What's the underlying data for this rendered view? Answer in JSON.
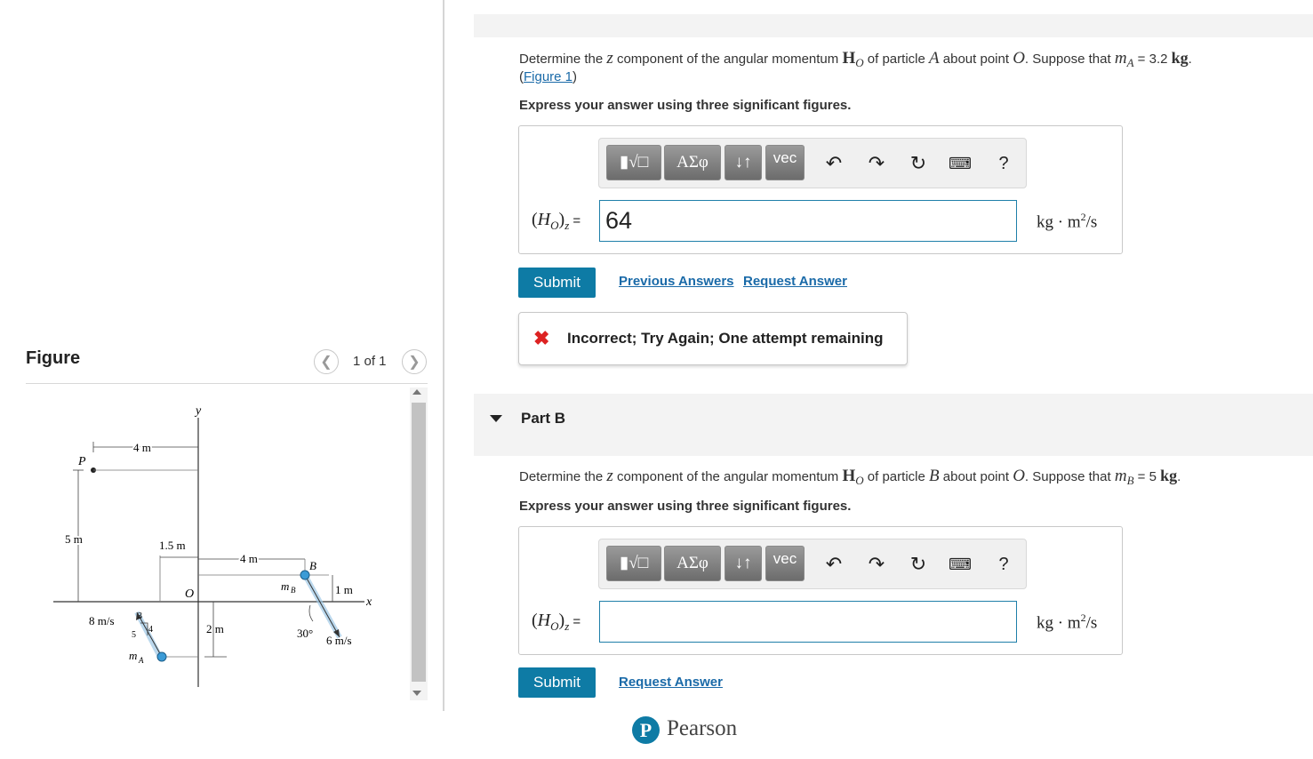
{
  "figure_panel": {
    "title": "Figure",
    "pager_text": "1 of 1",
    "prev_icon": "chevron-left-icon",
    "next_icon": "chevron-right-icon",
    "labels": {
      "y_axis": "y",
      "x_axis": "x",
      "origin": "O",
      "point_p": "P",
      "dim_4m_top": "4 m",
      "dim_5m": "5 m",
      "dim_1_5m": "1.5 m",
      "dim_4m_mid": "4 m",
      "dim_1m": "1 m",
      "dim_2m": "2 m",
      "point_b": "B",
      "mass_b": "m",
      "mass_b_sub": "B",
      "mass_a": "m",
      "mass_a_sub": "A",
      "speed_a": "8 m/s",
      "speed_b": "6 m/s",
      "angle_b": "30°",
      "tri_3": "3",
      "tri_4": "4",
      "tri_5": "5"
    }
  },
  "part_a": {
    "q_pre": "Determine the ",
    "q_z": "z",
    "q_mid1": " component of the angular momentum ",
    "q_H": "H",
    "q_Hsub": "O",
    "q_mid2": " of particle ",
    "q_particle": "A",
    "q_mid3": " about point ",
    "q_point": "O",
    "q_mid4": ". Suppose that ",
    "q_m": "m",
    "q_msub": "A",
    "q_eq": " = 3.2 ",
    "q_unit": "kg",
    "q_end": ".",
    "figure_link": "Figure 1",
    "instruction": "Express your answer using three significant figures.",
    "answer_label": "(HO)z =",
    "answer_value": "64",
    "units": "kg · m²/s",
    "submit_label": "Submit",
    "previous_answers_label": "Previous Answers",
    "request_answer_label": "Request Answer",
    "feedback": "Incorrect; Try Again; One attempt remaining"
  },
  "toolbar": {
    "templates_icon": "radical-template-icon",
    "greek_label": "ΑΣφ",
    "arrows_label": "↓↑",
    "vec_label": "vec",
    "undo_icon": "undo-icon",
    "redo_icon": "redo-icon",
    "reset_icon": "reset-icon",
    "keyboard_icon": "keyboard-icon",
    "help_label": "?"
  },
  "part_b": {
    "title": "Part B",
    "q_pre": "Determine the ",
    "q_z": "z",
    "q_mid1": " component of the angular momentum ",
    "q_H": "H",
    "q_Hsub": "O",
    "q_mid2": " of particle ",
    "q_particle": "B",
    "q_mid3": " about point ",
    "q_point": "O",
    "q_mid4": ". Suppose that ",
    "q_m": "m",
    "q_msub": "B",
    "q_eq": " = 5 ",
    "q_unit": "kg",
    "q_end": ".",
    "instruction": "Express your answer using three significant figures.",
    "answer_label": "(HO)z =",
    "answer_value": "",
    "units": "kg · m²/s",
    "submit_label": "Submit",
    "request_answer_label": "Request Answer"
  },
  "footer": {
    "brand": "Pearson",
    "logo_letter": "P"
  },
  "colors": {
    "accent": "#0e7ba5",
    "link": "#1a6aa8",
    "error": "#dd2222",
    "input_border": "#1f7fa9"
  }
}
